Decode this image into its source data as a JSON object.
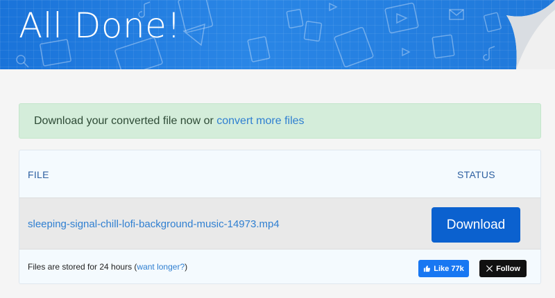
{
  "header": {
    "title": "All Done!",
    "accent_color": "#1f7ad9"
  },
  "alert": {
    "text": "Download your converted file now or ",
    "link": "convert more files"
  },
  "table": {
    "col_file": "FILE",
    "col_status": "STATUS",
    "file_name": "sleeping-signal-chill-lofi-background-music-14973.mp4",
    "download_label": "Download"
  },
  "footer": {
    "storage_text": "Files are stored for 24 hours (",
    "storage_link": "want longer?",
    "storage_end": ")",
    "like_label": "Like 77k",
    "follow_label": "Follow",
    "like_icon": "thumbs-up-icon",
    "follow_icon": "x-logo-icon"
  }
}
